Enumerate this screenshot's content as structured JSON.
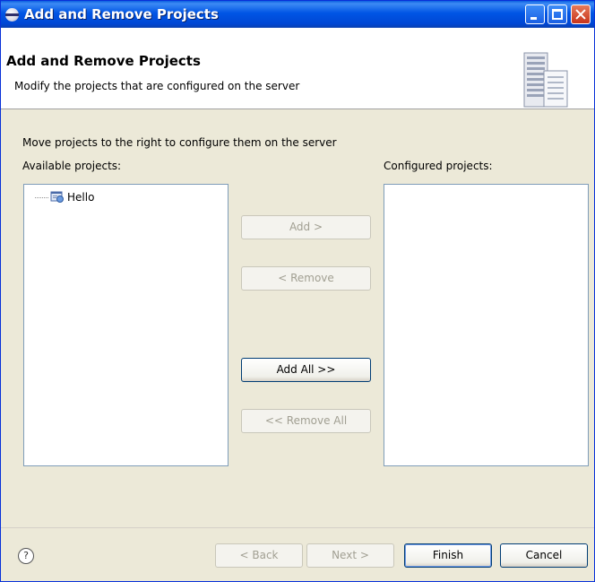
{
  "window": {
    "title": "Add and Remove Projects",
    "titlebar_icon": "eclipse-icon",
    "controls": [
      "minimize",
      "maximize",
      "close"
    ]
  },
  "header": {
    "title": "Add and Remove Projects",
    "description": "Modify the projects that are configured on the server",
    "icon": "server-icon"
  },
  "body": {
    "instruction": "Move projects to the right to configure them on the server",
    "available_label": "Available projects:",
    "configured_label": "Configured projects:",
    "available_projects": [
      {
        "label": "Hello",
        "icon": "web-project-icon"
      }
    ],
    "configured_projects": []
  },
  "buttons": {
    "add": "Add >",
    "remove": "< Remove",
    "add_all": "Add All >>",
    "remove_all": "<< Remove All"
  },
  "footer": {
    "help_glyph": "?",
    "back": "< Back",
    "next": "Next >",
    "finish": "Finish",
    "cancel": "Cancel"
  },
  "colors": {
    "titlebar": "#0055e5",
    "dialog_bg": "#ece9d8",
    "list_border": "#7f9db9",
    "disabled_text": "#a19f92"
  }
}
